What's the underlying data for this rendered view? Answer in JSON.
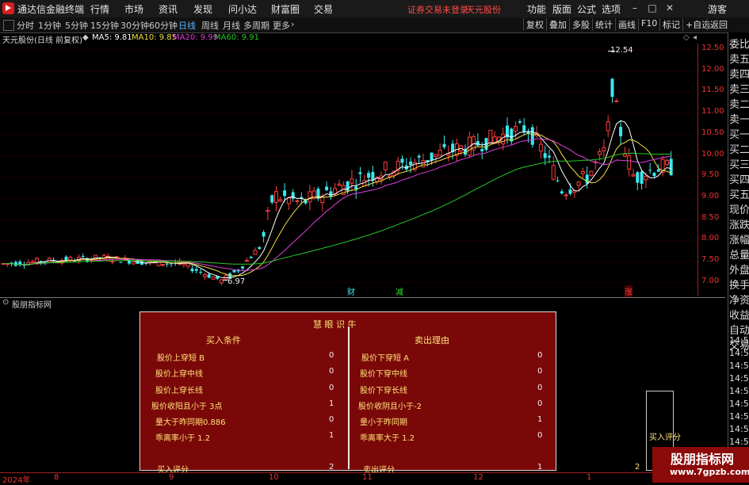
{
  "app": {
    "title": "通达信金融终端"
  },
  "menu": [
    "行情",
    "市场",
    "资讯",
    "发现",
    "问小达",
    "财富圈",
    "交易"
  ],
  "status": {
    "login": "证券交易未登录",
    "stock": "天元股份"
  },
  "right_menu": [
    "功能",
    "版面",
    "公式",
    "选项"
  ],
  "user": "游客",
  "periods": [
    "分时",
    "1分钟",
    "5分钟",
    "15分钟",
    "30分钟",
    "60分钟",
    "日线",
    "周线",
    "月线",
    "多周期",
    "更多"
  ],
  "active_period": "日线",
  "tools": [
    "复权",
    "叠加",
    "多股",
    "统计",
    "画线",
    "F10",
    "标记",
    "+自选",
    "返回"
  ],
  "info": {
    "name": "天元股份(日线 前复权)",
    "ma5": "MA5: 9.81",
    "ma10": "MA10: 9.85",
    "ma20": "MA20: 9.99",
    "ma60": "MA60: 9.91"
  },
  "colors": {
    "up": "#ff3c3c",
    "down": "#39e8f0",
    "ma5": "#ffffff",
    "ma10": "#f0e040",
    "ma20": "#e040e0",
    "ma60": "#28c828"
  },
  "price_ticks": [
    "12.50",
    "12.00",
    "11.50",
    "11.00",
    "10.50",
    "10.00",
    "9.50",
    "9.00",
    "8.50",
    "8.00",
    "7.50",
    "7.00"
  ],
  "annotations": {
    "high": "12.54",
    "low": "6.97"
  },
  "markers": [
    "财",
    "减",
    "涨"
  ],
  "side": [
    "委比",
    "卖五",
    "卖四",
    "卖三",
    "卖二",
    "卖一",
    "买一",
    "买二",
    "买三",
    "买四",
    "买五",
    "现价",
    "涨跌",
    "涨幅",
    "总量",
    "外盘",
    "换手",
    "净资",
    "收益",
    "自动",
    "交易"
  ],
  "side_times": [
    "14:5",
    "14:5",
    "14:5",
    "14:5",
    "14:5",
    "14:5",
    "14:5",
    "14:5",
    "14:5",
    "14:5",
    "14:5"
  ],
  "indicator": {
    "header": "股朋指标网",
    "title": "慧 眼 识 牛",
    "buy_title": "买入条件",
    "sell_title": "卖出理由",
    "buy_rows": [
      {
        "label": "股价上穿短 B",
        "value": "0"
      },
      {
        "label": "股价上穿中线",
        "value": "0"
      },
      {
        "label": "股价上穿长线",
        "value": "0"
      },
      {
        "label": "股价收阳且小于 3点",
        "value": "1"
      },
      {
        "label": "量大于昨同期0.886",
        "value": "0"
      },
      {
        "label": "乖离率小于 1.2",
        "value": "1"
      }
    ],
    "sell_rows": [
      {
        "label": "股价下穿短 A",
        "value": "0"
      },
      {
        "label": "股价下穿中线",
        "value": "0"
      },
      {
        "label": "股价下穿长线",
        "value": "0"
      },
      {
        "label": "股价收阴且小于-2",
        "value": "0"
      },
      {
        "label": "量小于昨同期",
        "value": "1"
      },
      {
        "label": "乖离率大于 1.2",
        "value": "0"
      }
    ],
    "buy_score_label": "买入评分",
    "buy_score": "2",
    "sell_score_label": "卖出评分",
    "sell_score": "1",
    "bar_label": "买入评分",
    "bar_value": "2"
  },
  "dates": [
    "2024年",
    "8",
    "9",
    "10",
    "11",
    "12",
    "1"
  ],
  "watermark": {
    "line1": "股朋指标网",
    "line2": "www.7gpzb.com"
  }
}
